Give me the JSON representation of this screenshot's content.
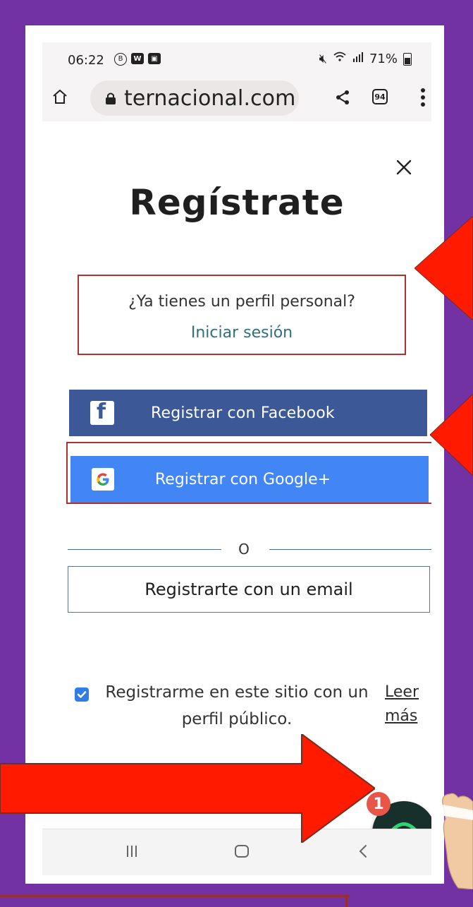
{
  "status_bar": {
    "time": "06:22",
    "left_icons": [
      "B",
      "W",
      "▣"
    ],
    "battery_percent": "71%"
  },
  "browser": {
    "url": "ternacional.com",
    "tabs_count": "94"
  },
  "page": {
    "title": "Regístrate",
    "login_prompt": "¿Ya tienes un perfil personal?",
    "login_link": "Iniciar sesión",
    "facebook_button": "Registrar con Facebook",
    "google_button": "Registrar con Google+",
    "divider_text": "O",
    "email_button": "Registrarte con un email",
    "consent_text": "Registrarme en este sitio con un perfil público.",
    "read_more": "Leer más",
    "support_badge_count": "1"
  },
  "colors": {
    "facebook": "#3c5897",
    "google": "#4285f4",
    "checkbox": "#2f7ee7",
    "annotation_red": "#ff1a00",
    "outline_red": "#b03030",
    "frame_purple": "#7232a4"
  }
}
